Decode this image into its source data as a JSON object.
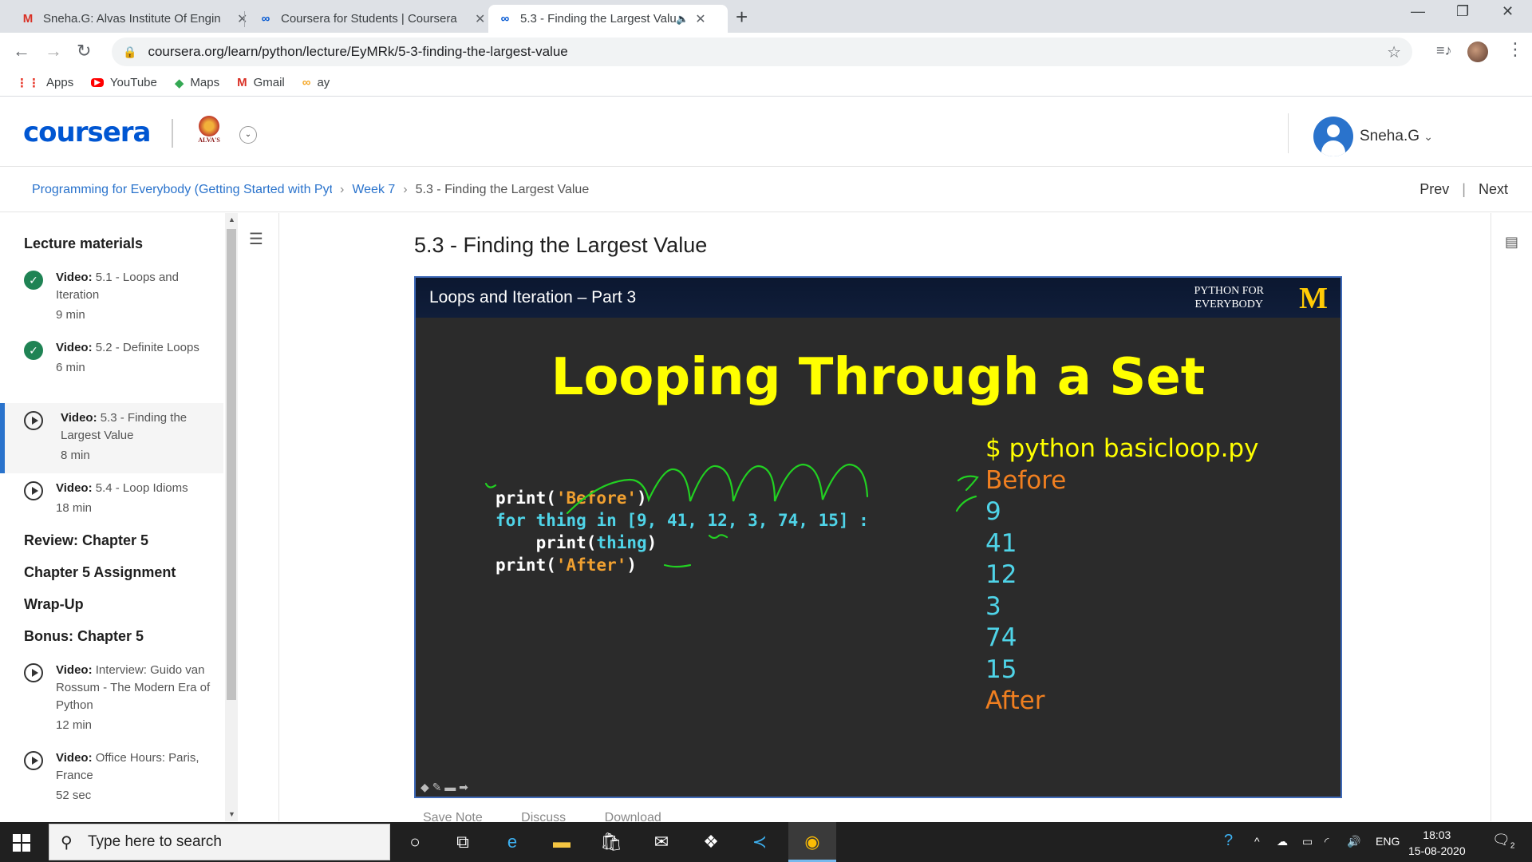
{
  "browser": {
    "tabs": [
      {
        "label": "Sneha.G: Alvas Institute Of Engin",
        "favicon": "gmail-icon"
      },
      {
        "label": "Coursera for Students | Coursera",
        "favicon": "coursera-icon"
      },
      {
        "label": "5.3 - Finding the Largest Valu",
        "favicon": "coursera-icon"
      }
    ],
    "url": "coursera.org/learn/python/lecture/EyMRk/5-3-finding-the-largest-value",
    "bookmarks": [
      {
        "label": "Apps",
        "icon": "apps-grid-icon"
      },
      {
        "label": "YouTube",
        "icon": "youtube-icon"
      },
      {
        "label": "Maps",
        "icon": "maps-icon"
      },
      {
        "label": "Gmail",
        "icon": "gmail-icon"
      },
      {
        "label": "ay",
        "icon": "coursera-icon"
      }
    ]
  },
  "header": {
    "logo": "coursera",
    "institution_mark": "ALVA'S",
    "user_name": "Sneha.G"
  },
  "breadcrumb": {
    "course": "Programming for Everybody (Getting Started with Pyth",
    "week": "Week 7",
    "current": "5.3 - Finding the Largest Value",
    "prev": "Prev",
    "next": "Next"
  },
  "sidebar": {
    "heading": "Lecture materials",
    "items": [
      {
        "kind": "Video:",
        "title": "5.1 - Loops and Iteration",
        "duration": "9 min",
        "status": "done"
      },
      {
        "kind": "Video:",
        "title": "5.2 - Definite Loops",
        "duration": "6 min",
        "status": "done"
      },
      {
        "kind": "Video:",
        "title": "5.3 - Finding the Largest Value",
        "duration": "8 min",
        "status": "active"
      },
      {
        "kind": "Video:",
        "title": "5.4 - Loop Idioms",
        "duration": "18 min",
        "status": "todo"
      }
    ],
    "sections": [
      "Review: Chapter 5",
      "Chapter 5 Assignment",
      "Wrap-Up",
      "Bonus: Chapter 5"
    ],
    "bonus_items": [
      {
        "kind": "Video:",
        "title": "Interview: Guido van Rossum - The Modern Era of Python",
        "duration": "12 min"
      },
      {
        "kind": "Video:",
        "title": "Office Hours: Paris, France",
        "duration": "52 sec"
      }
    ]
  },
  "lecture": {
    "title": "5.3 - Finding the Largest Value",
    "video_header": "Loops and Iteration – Part 3",
    "brand_line1": "PYTHON FOR",
    "brand_line2": "EVERYBODY",
    "brand_mark": "M",
    "slide_title": "Looping Through a Set",
    "code": {
      "l1_a": "print(",
      "l1_b": "'Before'",
      "l1_c": ")",
      "l2_a": "for ",
      "l2_b": "thing",
      "l2_c": " in ",
      "l2_d": "[9, 41, 12, 3, 74, 15]",
      "l2_e": " :",
      "l3_a": "    print(",
      "l3_b": "thing",
      "l3_c": ")",
      "l4_a": "print(",
      "l4_b": "'After'",
      "l4_c": ")"
    },
    "output": [
      "$ python basicloop.py",
      "Before",
      "9",
      "41",
      "12",
      "3",
      "74",
      "15",
      "After"
    ]
  },
  "actions": [
    "Save Note",
    "Discuss",
    "Download"
  ],
  "taskbar": {
    "search_placeholder": "Type here to search",
    "language": "ENG",
    "time": "18:03",
    "date": "15-08-2020",
    "notifications": "2"
  },
  "colors": {
    "coursera_blue": "#0056d2",
    "link_blue": "#2a73cc",
    "slide_yellow": "#ffff00",
    "slide_orange": "#f07f20",
    "slide_cyan": "#4fd4e8",
    "ink_green": "#22d022"
  }
}
